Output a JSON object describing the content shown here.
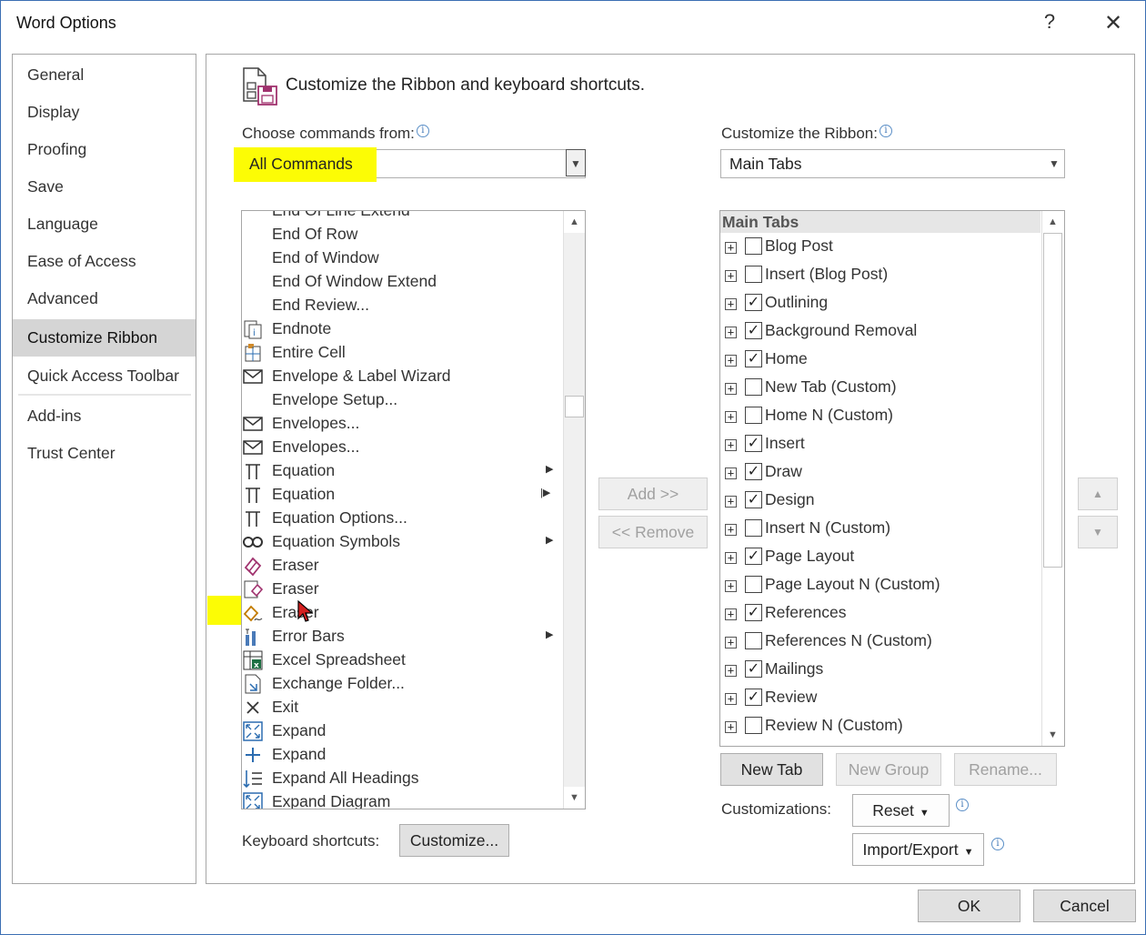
{
  "window": {
    "title": "Word Options",
    "help_label": "?",
    "close_label": "✕"
  },
  "nav": {
    "items": [
      {
        "label": "General"
      },
      {
        "label": "Display"
      },
      {
        "label": "Proofing"
      },
      {
        "label": "Save"
      },
      {
        "label": "Language"
      },
      {
        "label": "Ease of Access"
      },
      {
        "label": "Advanced"
      },
      {
        "label": "Customize Ribbon",
        "selected": true
      },
      {
        "label": "Quick Access Toolbar"
      },
      {
        "label": "Add-ins"
      },
      {
        "label": "Trust Center"
      }
    ]
  },
  "header": {
    "text": "Customize the Ribbon and keyboard shortcuts."
  },
  "commands": {
    "label": "Choose commands from:",
    "selected": "All Commands",
    "list": [
      {
        "label": "End Of Line Extend",
        "icon": "none"
      },
      {
        "label": "End Of Row",
        "icon": "none"
      },
      {
        "label": "End of Window",
        "icon": "none"
      },
      {
        "label": "End Of Window Extend",
        "icon": "none"
      },
      {
        "label": "End Review...",
        "icon": "none"
      },
      {
        "label": "Endnote",
        "icon": "endnote-icon"
      },
      {
        "label": "Entire Cell",
        "icon": "entire-cell-icon"
      },
      {
        "label": "Envelope & Label Wizard",
        "icon": "envelope-icon"
      },
      {
        "label": "Envelope Setup...",
        "icon": "none"
      },
      {
        "label": "Envelopes...",
        "icon": "envelope-icon"
      },
      {
        "label": "Envelopes...",
        "icon": "envelope-icon"
      },
      {
        "label": "Equation",
        "icon": "pi-icon",
        "submenu": "arrow"
      },
      {
        "label": "Equation",
        "icon": "pi-icon",
        "submenu": "split"
      },
      {
        "label": "Equation Options...",
        "icon": "pi-icon"
      },
      {
        "label": "Equation Symbols",
        "icon": "infinity-icon",
        "submenu": "arrow"
      },
      {
        "label": "Eraser",
        "icon": "eraser-icon"
      },
      {
        "label": "Eraser",
        "icon": "table-eraser-icon"
      },
      {
        "label": "Eraser",
        "icon": "pen-eraser-icon",
        "highlighted": true
      },
      {
        "label": "Error Bars",
        "icon": "error-bars-icon",
        "submenu": "arrow"
      },
      {
        "label": "Excel Spreadsheet",
        "icon": "excel-icon"
      },
      {
        "label": "Exchange Folder...",
        "icon": "exchange-folder-icon"
      },
      {
        "label": "Exit",
        "icon": "x-icon"
      },
      {
        "label": "Expand",
        "icon": "expand-icon"
      },
      {
        "label": "Expand",
        "icon": "plus-icon"
      },
      {
        "label": "Expand All Headings",
        "icon": "headings-icon"
      },
      {
        "label": "Expand Diagram",
        "icon": "expand-icon"
      }
    ]
  },
  "ribbon": {
    "label": "Customize the Ribbon:",
    "selected": "Main Tabs",
    "list_header": "Main Tabs",
    "tabs": [
      {
        "label": "Blog Post",
        "checked": false
      },
      {
        "label": "Insert (Blog Post)",
        "checked": false
      },
      {
        "label": "Outlining",
        "checked": true
      },
      {
        "label": "Background Removal",
        "checked": true
      },
      {
        "label": " Home",
        "checked": true
      },
      {
        "label": "New Tab (Custom)",
        "checked": false
      },
      {
        "label": "Home N (Custom)",
        "checked": false
      },
      {
        "label": "Insert",
        "checked": true
      },
      {
        "label": "Draw",
        "checked": true
      },
      {
        "label": "Design",
        "checked": true
      },
      {
        "label": "Insert N (Custom)",
        "checked": false
      },
      {
        "label": "Page Layout",
        "checked": true
      },
      {
        "label": "Page Layout N (Custom)",
        "checked": false
      },
      {
        "label": "References",
        "checked": true
      },
      {
        "label": "References N (Custom)",
        "checked": false
      },
      {
        "label": "Mailings",
        "checked": true
      },
      {
        "label": "Review",
        "checked": true
      },
      {
        "label": "Review N (Custom)",
        "checked": false
      }
    ]
  },
  "buttons": {
    "add": "Add >>",
    "remove": "<< Remove",
    "new_tab": "New Tab",
    "new_group": "New Group",
    "rename": "Rename...",
    "reset": "Reset",
    "import_export": "Import/Export",
    "customize": "Customize...",
    "ok": "OK",
    "cancel": "Cancel"
  },
  "labels": {
    "customizations": "Customizations:",
    "keyboard_shortcuts": "Keyboard shortcuts:"
  },
  "colors": {
    "highlight": "#fcfc05",
    "selected_nav": "#d5d5d5",
    "border": "#a6a6a6"
  }
}
